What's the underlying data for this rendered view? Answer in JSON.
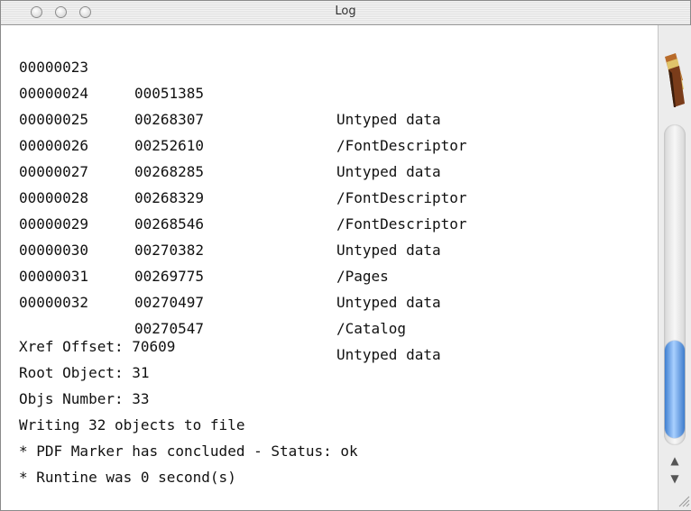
{
  "window": {
    "title": "Log"
  },
  "entries": [
    {
      "id": "00000023",
      "offset": "00051385",
      "type": "Untyped data"
    },
    {
      "id": "00000024",
      "offset": "00268307",
      "type": "/FontDescriptor"
    },
    {
      "id": "00000025",
      "offset": "00252610",
      "type": "Untyped data"
    },
    {
      "id": "00000026",
      "offset": "00268285",
      "type": "/FontDescriptor"
    },
    {
      "id": "00000027",
      "offset": "00268329",
      "type": "/FontDescriptor"
    },
    {
      "id": "00000028",
      "offset": "00268546",
      "type": "Untyped data"
    },
    {
      "id": "00000029",
      "offset": "00270382",
      "type": "/Pages"
    },
    {
      "id": "00000030",
      "offset": "00269775",
      "type": "Untyped data"
    },
    {
      "id": "00000031",
      "offset": "00270497",
      "type": "/Catalog"
    },
    {
      "id": "00000032",
      "offset": "00270547",
      "type": "Untyped data"
    }
  ],
  "summary": [
    "Xref Offset: 70609",
    "Root Object: 31",
    "Objs Number: 33",
    "Writing 32 objects to file",
    "* PDF Marker has concluded - Status: ok",
    "* Runtine was 0 second(s)"
  ],
  "icons": {
    "close": "circle-icon",
    "minimize": "circle-icon",
    "zoom": "circle-icon",
    "scroll_up": "arrow-up-icon",
    "scroll_down": "arrow-down-icon",
    "resize": "resize-grip-icon"
  }
}
